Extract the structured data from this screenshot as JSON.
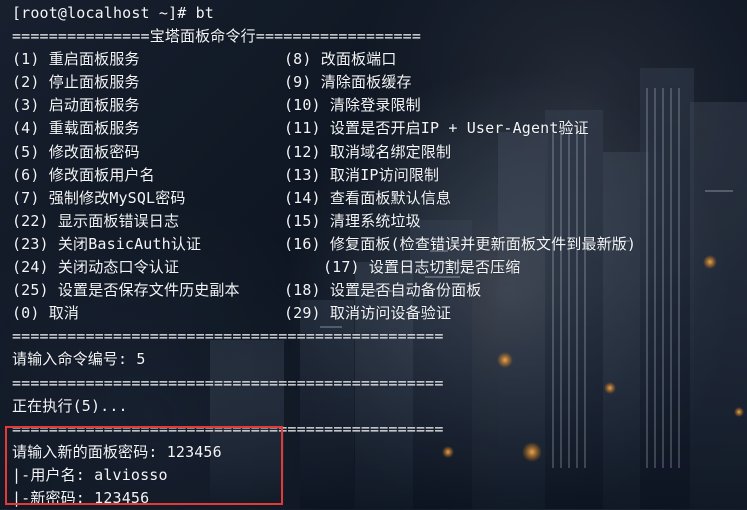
{
  "terminal": {
    "prompt_line": "[root@localhost ~]# bt",
    "menu_title_line": "===============宝塔面板命令行==================",
    "menu_rows": [
      {
        "left": "(1) 重启面板服务",
        "right": "(8) 改面板端口",
        "right_shift": false
      },
      {
        "left": "(2) 停止面板服务",
        "right": "(9) 清除面板缓存",
        "right_shift": false
      },
      {
        "left": "(3) 启动面板服务",
        "right": "(10) 清除登录限制",
        "right_shift": false
      },
      {
        "left": "(4) 重载面板服务",
        "right": "(11) 设置是否开启IP + User-Agent验证",
        "right_shift": false
      },
      {
        "left": "(5) 修改面板密码",
        "right": "(12) 取消域名绑定限制",
        "right_shift": false
      },
      {
        "left": "(6) 修改面板用户名",
        "right": "(13) 取消IP访问限制",
        "right_shift": false
      },
      {
        "left": "(7) 强制修改MySQL密码",
        "right": "(14) 查看面板默认信息",
        "right_shift": false
      },
      {
        "left": "(22) 显示面板错误日志",
        "right": "(15) 清理系统垃圾",
        "right_shift": false
      },
      {
        "left": "(23) 关闭BasicAuth认证",
        "right": "(16) 修复面板(检查错误并更新面板文件到最新版)",
        "right_shift": false
      },
      {
        "left": "(24) 关闭动态口令认证",
        "right": "(17) 设置日志切割是否压缩",
        "right_shift": true
      },
      {
        "left": "(25) 设置是否保存文件历史副本",
        "right": "(18) 设置是否自动备份面板",
        "right_shift": false
      },
      {
        "left": "(0) 取消",
        "right": "(29) 取消访问设备验证",
        "right_shift": false
      }
    ],
    "separator_line": "===============================================",
    "input_prompt_line": "请输入命令编号: 5",
    "executing_line": "正在执行(5)...",
    "new_password_line": "请输入新的面板密码: 123456",
    "username_line": "|-用户名: alviosso",
    "new_password_result_line": "|-新密码: 123456"
  },
  "colors": {
    "text": "#f3f5f8",
    "highlight_border": "#e53935",
    "background_dark": "#0f1724"
  }
}
